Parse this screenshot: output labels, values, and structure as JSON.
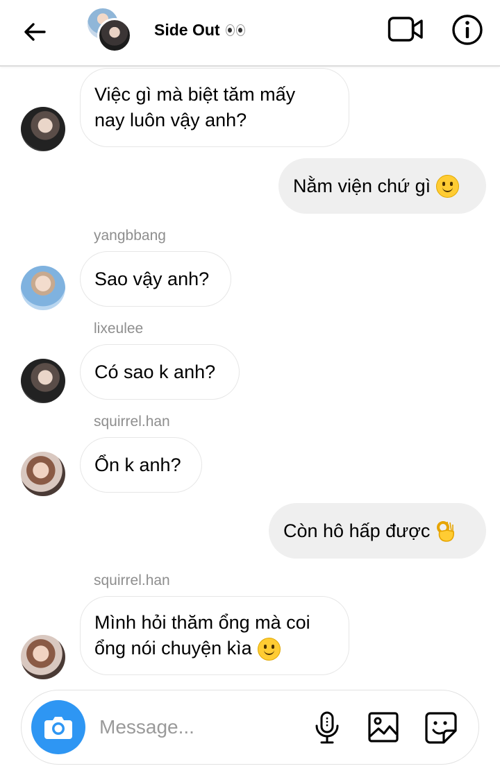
{
  "header": {
    "title": "Side Out",
    "back_icon": "back-arrow-icon",
    "video_icon": "video-call-icon",
    "info_icon": "info-icon"
  },
  "messages": [
    {
      "direction": "incoming",
      "text": "Việc gì mà biệt tăm mấy\nnay luôn vậy anh?"
    },
    {
      "direction": "outgoing",
      "text": "Nằm viện chứ gì",
      "emoji": "slightly-smiling-face"
    },
    {
      "direction": "incoming",
      "sender": "yangbbang",
      "text": "Sao vậy anh?"
    },
    {
      "direction": "incoming",
      "sender": "lixeulee",
      "text": "Có sao k anh?"
    },
    {
      "direction": "incoming",
      "sender": "squirrel.han",
      "text": "Ổn k anh?"
    },
    {
      "direction": "outgoing",
      "text": "Còn hô hấp được",
      "emoji": "ok-hand"
    },
    {
      "direction": "incoming",
      "sender": "squirrel.han",
      "text": "Mình hỏi thăm ổng mà coi\nổng nói chuyện kìa",
      "emoji": "slightly-smiling-face"
    }
  ],
  "composer": {
    "placeholder": "Message...",
    "camera_icon": "camera-icon",
    "mic_icon": "microphone-icon",
    "gallery_icon": "gallery-icon",
    "sticker_icon": "sticker-icon",
    "camera_color": "#2E96F3"
  }
}
